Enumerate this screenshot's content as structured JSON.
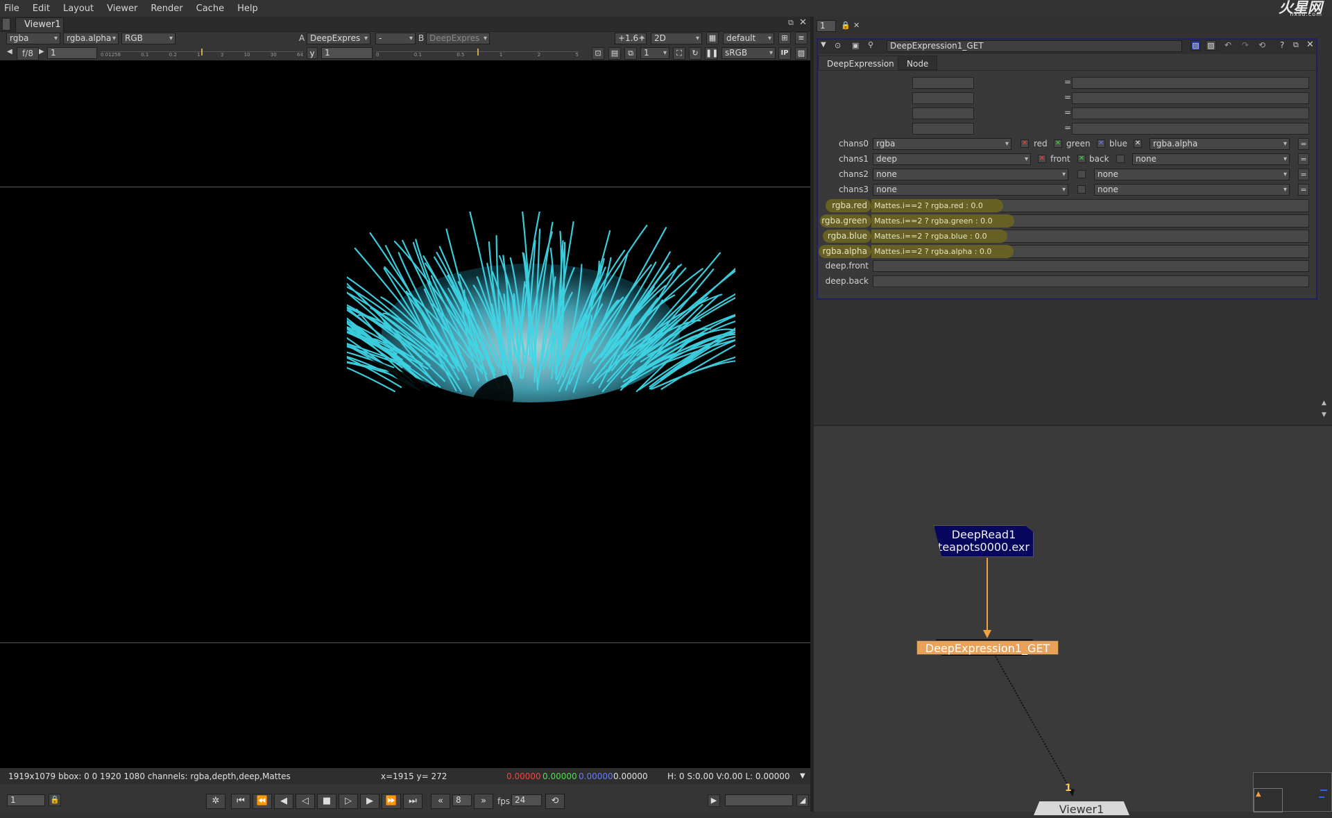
{
  "menu": [
    "File",
    "Edit",
    "Layout",
    "Viewer",
    "Render",
    "Cache",
    "Help"
  ],
  "logo": {
    "brand": "火星网",
    "url_text": "hxsd.com"
  },
  "viewer_tab": "Viewer1",
  "viewer_toolbar": {
    "channels": "rgba",
    "alpha_channel": "rgba.alpha",
    "display": "RGB",
    "a_label": "A",
    "a_input": "DeepExpres",
    "op": "-",
    "b_label": "B",
    "b_input": "DeepExpres",
    "zoom": "+1.6+",
    "view_mode": "2D",
    "lut": "default"
  },
  "viewer_toolbar2": {
    "fstop": "f/8",
    "frame": "1",
    "y_label": "y",
    "y_value": "1",
    "proxy": "1",
    "colorspace": "sRGB",
    "ip": "IP"
  },
  "ruler_left": [
    "0.01258",
    "0.1",
    "0.2",
    "1",
    "3",
    "10",
    "30",
    "64"
  ],
  "ruler_right": [
    "0",
    "0.1",
    "0.5",
    "1",
    "2",
    "5"
  ],
  "status": {
    "info": "1919x1079 bbox: 0 0 1920 1080 channels: rgba,depth,deep,Mattes",
    "coords": "x=1915 y= 272",
    "r": "0.00000",
    "g": "0.00000",
    "b": "0.00000",
    "a": "0.00000",
    "hsv": "H:  0 S:0.00 V:0.00  L: 0.00000"
  },
  "transport": {
    "frame": "1",
    "step": "8",
    "fps_label": "fps",
    "fps": "24"
  },
  "panel_top": {
    "count": "1"
  },
  "properties": {
    "node_name": "DeepExpression1_GET",
    "tabs": [
      "DeepExpression",
      "Node"
    ],
    "chans": [
      {
        "label": "chans0",
        "layer": "rgba",
        "channels": [
          {
            "name": "red",
            "state": "x",
            "color": "red"
          },
          {
            "name": "green",
            "state": "x",
            "color": "green"
          },
          {
            "name": "blue",
            "state": "x",
            "color": "blue"
          }
        ],
        "extra": "rgba.alpha"
      },
      {
        "label": "chans1",
        "layer": "deep",
        "channels": [
          {
            "name": "front",
            "state": "x",
            "color": "red"
          },
          {
            "name": "back",
            "state": "x",
            "color": "green"
          }
        ],
        "extra": "none"
      },
      {
        "label": "chans2",
        "layer": "none",
        "channels": [],
        "extra": "none"
      },
      {
        "label": "chans3",
        "layer": "none",
        "channels": [],
        "extra": "none"
      }
    ],
    "expressions": [
      {
        "label": "rgba.red",
        "value": "Mattes.i==2 ? rgba.red : 0.0"
      },
      {
        "label": "rgba.green",
        "value": "Mattes.i==2 ? rgba.green : 0.0"
      },
      {
        "label": "rgba.blue",
        "value": "Mattes.i==2 ? rgba.blue : 0.0"
      },
      {
        "label": "rgba.alpha",
        "value": "Mattes.i==2 ? rgba.alpha : 0.0"
      }
    ],
    "deep_fields": [
      {
        "label": "deep.front",
        "value": ""
      },
      {
        "label": "deep.back",
        "value": ""
      }
    ],
    "eq_sign": "="
  },
  "nodegraph": {
    "read_node": {
      "name": "DeepRead1",
      "file": "teapots0000.exr"
    },
    "expr_node": "DeepExpression1_GET",
    "viewer_node": "Viewer1",
    "viewer_input": "1"
  },
  "colors": {
    "accent_node": "#e8a25a",
    "read_node": "#07075e",
    "expr_highlight": "#676024",
    "hair": "#3fd6e6"
  }
}
